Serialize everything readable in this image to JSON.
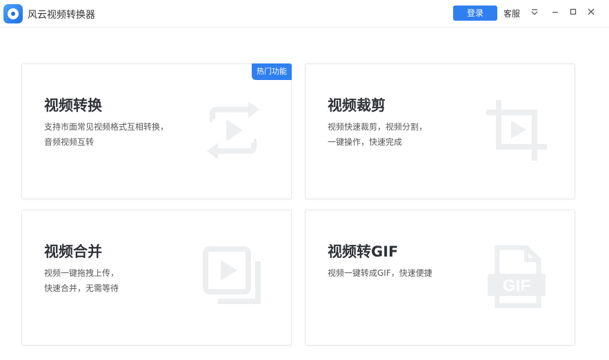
{
  "app": {
    "title": "风云视频转换器",
    "login_label": "登录",
    "service_label": "客服"
  },
  "colors": {
    "accent": "#2f7ff0",
    "card_border": "#e3e6ea",
    "icon_gray": "#eceef0"
  },
  "icons": {
    "logo": "app-logo-icon",
    "menu": "menu-icon",
    "minimize": "minimize-icon",
    "maximize": "maximize-icon",
    "close": "close-icon"
  },
  "cards": [
    {
      "title": "视频转换",
      "desc_lines": [
        "支持市面常见视频格式互相转换，",
        "音频视频互转"
      ],
      "badge": "热门功能",
      "icon": "video-convert-icon"
    },
    {
      "title": "视频裁剪",
      "desc_lines": [
        "视频快速裁剪，视频分割，",
        "一键操作，快速完成"
      ],
      "icon": "video-crop-icon"
    },
    {
      "title": "视频合并",
      "desc_lines": [
        "视频一键拖拽上传，",
        "快速合并，无需等待"
      ],
      "icon": "video-merge-icon"
    },
    {
      "title": "视频转GIF",
      "desc_lines": [
        "视频一键转成GIF，快速便捷"
      ],
      "icon_text": "GIF",
      "icon": "video-gif-icon"
    }
  ]
}
